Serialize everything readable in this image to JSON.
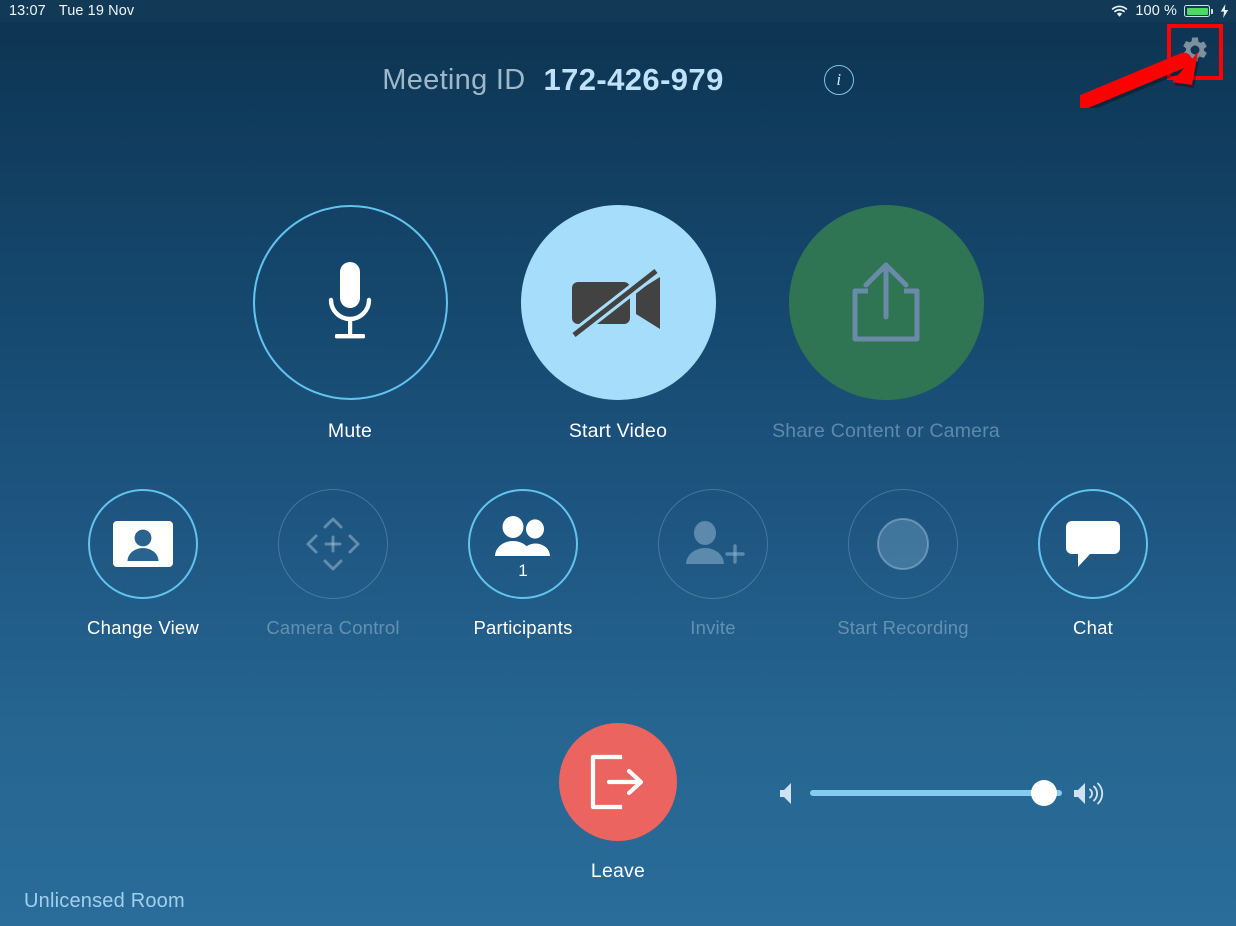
{
  "status_bar": {
    "time": "13:07",
    "date": "Tue 19 Nov",
    "battery_percent": "100 %",
    "wifi_icon": "wifi-icon",
    "battery_icon": "battery-icon",
    "charging_icon": "lightning-bolt-icon"
  },
  "header": {
    "meeting_label": "Meeting ID",
    "meeting_id": "172-426-979",
    "info_icon": "info-icon",
    "info_glyph": "i",
    "settings_icon": "gear-icon"
  },
  "annotation": {
    "highlight_color": "#fe0000",
    "arrow": "red-arrow-annotation",
    "target": "settings-gear-button"
  },
  "main_controls": [
    {
      "id": "mute",
      "label": "Mute",
      "icon": "microphone-icon",
      "style": "outlined",
      "enabled": true
    },
    {
      "id": "start-video",
      "label": "Start Video",
      "icon": "video-off-icon",
      "style": "filled-blue",
      "enabled": true
    },
    {
      "id": "share-content",
      "label": "Share Content or Camera",
      "icon": "share-upload-icon",
      "style": "filled-green",
      "enabled": false
    }
  ],
  "secondary_controls": [
    {
      "id": "change-view",
      "label": "Change View",
      "icon": "person-card-icon",
      "style": "outlined",
      "enabled": true,
      "badge": ""
    },
    {
      "id": "camera-control",
      "label": "Camera Control",
      "icon": "camera-dpad-icon",
      "style": "outlined-dim",
      "enabled": false,
      "badge": ""
    },
    {
      "id": "participants",
      "label": "Participants",
      "icon": "people-icon",
      "style": "outlined",
      "enabled": true,
      "badge": "1"
    },
    {
      "id": "invite",
      "label": "Invite",
      "icon": "person-add-icon",
      "style": "outlined-dim",
      "enabled": false,
      "badge": ""
    },
    {
      "id": "start-recording",
      "label": "Start Recording",
      "icon": "record-circle-icon",
      "style": "outlined-dim",
      "enabled": false,
      "badge": ""
    },
    {
      "id": "chat",
      "label": "Chat",
      "icon": "chat-bubble-icon",
      "style": "outlined",
      "enabled": true,
      "badge": ""
    }
  ],
  "leave": {
    "label": "Leave",
    "icon": "exit-door-icon",
    "color": "#eb645f"
  },
  "volume": {
    "low_icon": "speaker-low-icon",
    "high_icon": "speaker-high-icon",
    "level_percent": 93,
    "track_color": "#85cdf0"
  },
  "footer": {
    "room_status": "Unlicensed Room"
  },
  "theme": {
    "bg_top": "#0d3350",
    "bg_bottom": "#2a6c9a",
    "accent": "#63c3ef",
    "video_fill": "#a5ddfa",
    "share_fill": "#2f7554",
    "leave_fill": "#eb645f",
    "battery_green": "#4cd964"
  }
}
